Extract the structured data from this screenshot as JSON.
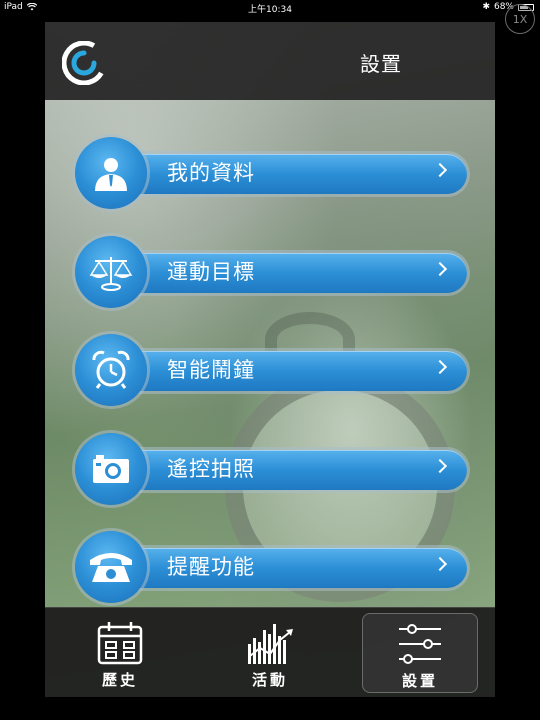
{
  "status_bar": {
    "device": "iPad",
    "time": "上午10:34",
    "battery": "68%",
    "battery_level": 0.68
  },
  "zoom_badge": "1X",
  "header": {
    "title": "設置",
    "logo_icon": "app-logo-icon"
  },
  "menu": [
    {
      "label": "我的資料",
      "icon": "user-profile-icon"
    },
    {
      "label": "運動目標",
      "icon": "scale-balance-icon"
    },
    {
      "label": "智能鬧鐘",
      "icon": "alarm-clock-icon"
    },
    {
      "label": "遙控拍照",
      "icon": "camera-icon"
    },
    {
      "label": "提醒功能",
      "icon": "phone-icon"
    }
  ],
  "tabbar": {
    "tabs": [
      {
        "label": "歷史",
        "icon": "calendar-icon",
        "active": false
      },
      {
        "label": "活動",
        "icon": "activity-chart-icon",
        "active": false
      },
      {
        "label": "設置",
        "icon": "sliders-icon",
        "active": true
      }
    ]
  },
  "colors": {
    "accent_blue": "#2c8fd6",
    "header_bg": "#232323",
    "logo_cyan": "#2aa7dc"
  }
}
